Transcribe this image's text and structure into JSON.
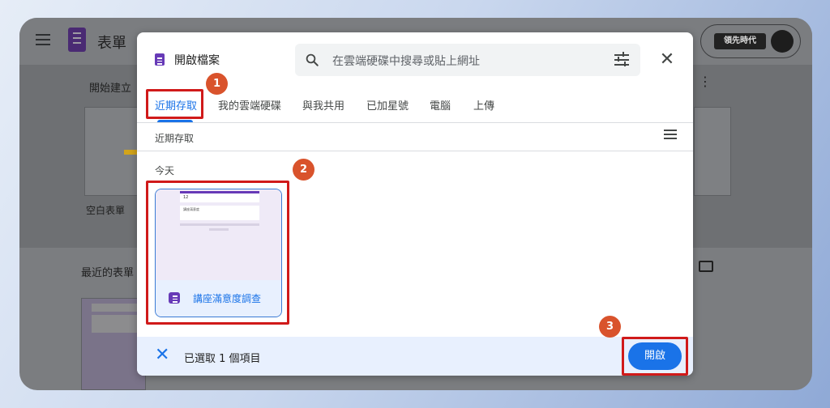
{
  "background_app": {
    "title": "表單",
    "start_section": "開始建立",
    "blank_form_label": "空白表單",
    "recent_section": "最近的表單",
    "brand_logo_text": "領先時代"
  },
  "dialog": {
    "title": "開啟檔案",
    "search": {
      "placeholder": "在雲端硬碟中搜尋或貼上網址"
    },
    "tabs": [
      {
        "label": "近期存取",
        "active": true
      },
      {
        "label": "我的雲端硬碟",
        "active": false
      },
      {
        "label": "與我共用",
        "active": false
      },
      {
        "label": "已加星號",
        "active": false
      },
      {
        "label": "電腦",
        "active": false
      },
      {
        "label": "上傳",
        "active": false
      }
    ],
    "breadcrumb": "近期存取",
    "section_label": "今天",
    "file": {
      "name": "講座滿意度調查",
      "thumb_title": "12",
      "thumb_line": "講座滿意度",
      "thumb_sub": "Google Forms"
    },
    "footer": {
      "selected_text": "已選取 1 個項目",
      "open_label": "開啟"
    }
  },
  "annotations": [
    "1",
    "2",
    "3"
  ],
  "colors": {
    "accent": "#1a73e8",
    "highlight": "#d01a1a",
    "badge": "#d9532c",
    "forms_purple": "#673ab7"
  }
}
